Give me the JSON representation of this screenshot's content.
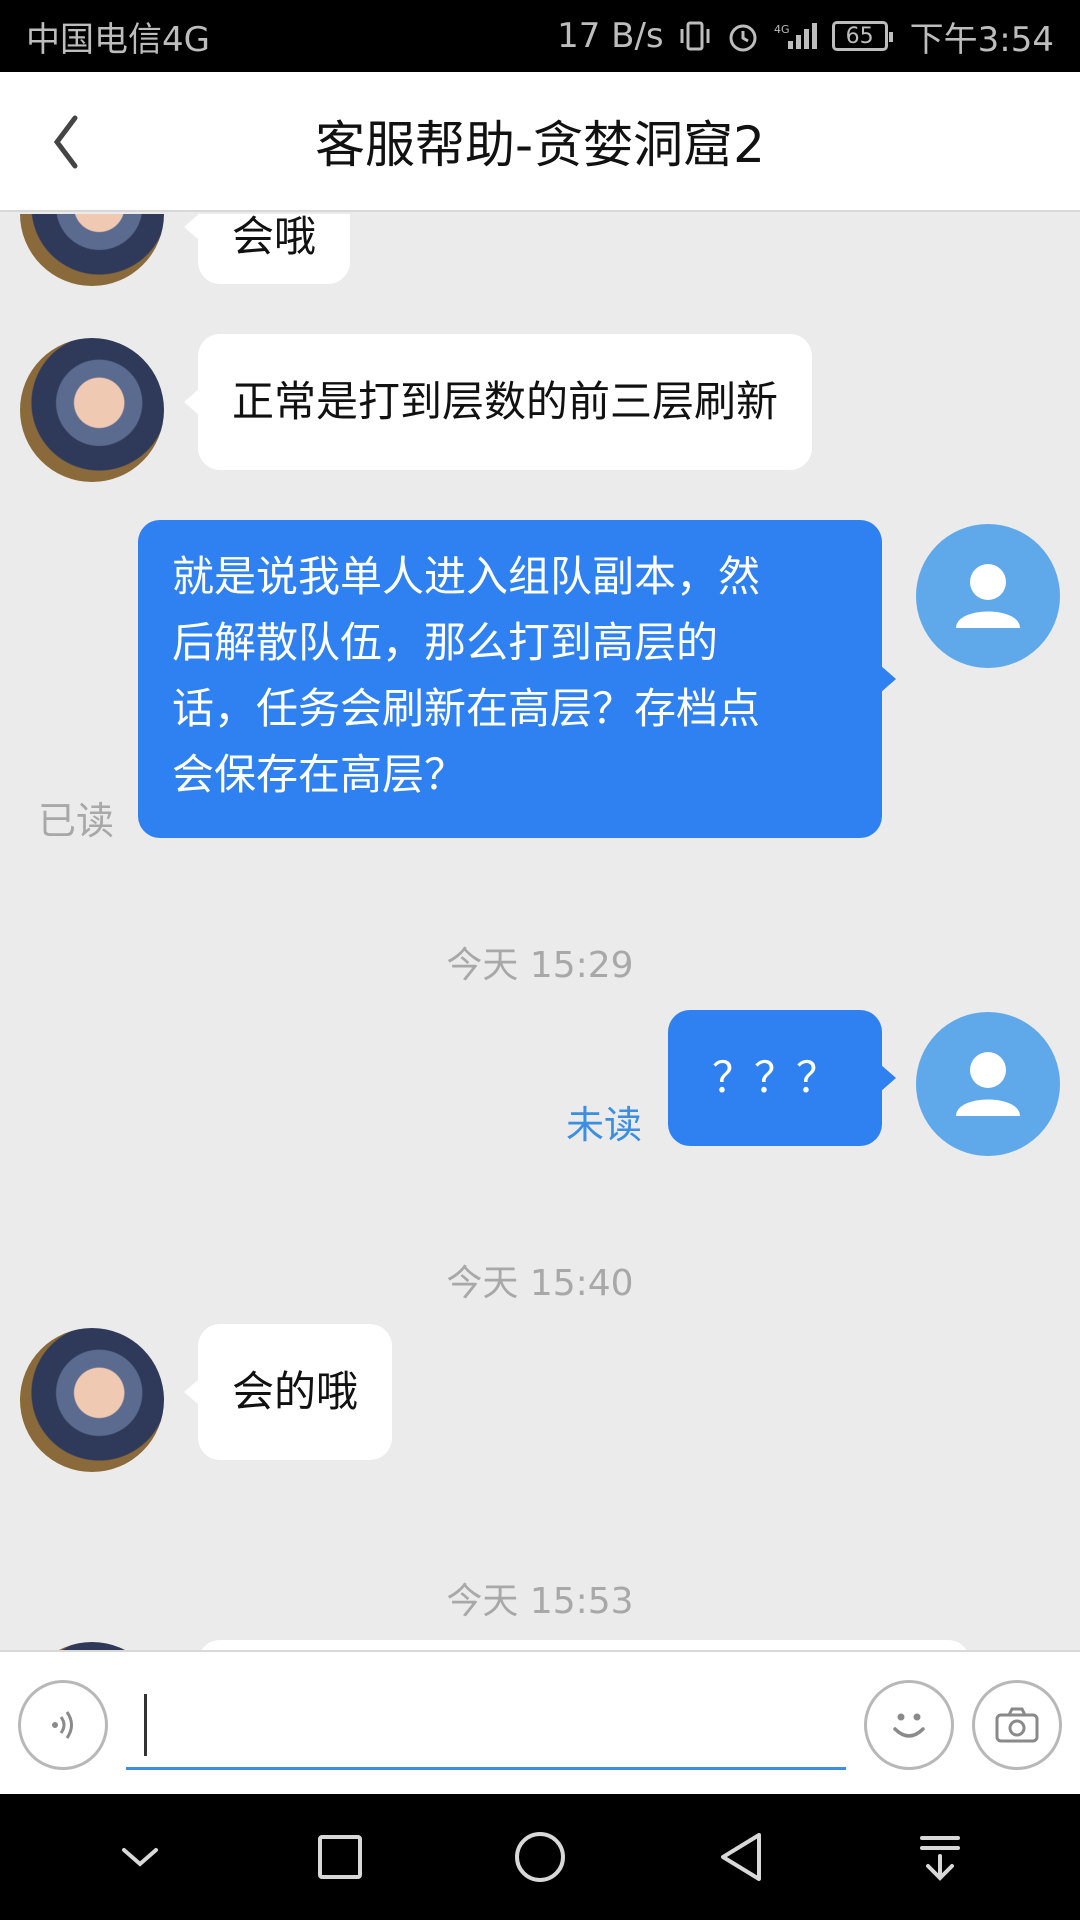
{
  "status_bar": {
    "carrier": "中国电信4G",
    "net_speed": "17 B/s",
    "battery": "65",
    "time": "下午3:54"
  },
  "header": {
    "title": "客服帮助-贪婪洞窟2"
  },
  "messages": [
    {
      "side": "in",
      "text": "会哦"
    },
    {
      "side": "in",
      "text": "正常是打到层数的前三层刷新"
    },
    {
      "side": "out",
      "lines": [
        "就是说我单人进入组队副本，然",
        "后解散队伍，那么打到高层的",
        "话，任务会刷新在高层？存档点",
        "会保存在高层？"
      ],
      "status": "已读"
    },
    {
      "type": "timestamp",
      "text": "今天 15:29"
    },
    {
      "side": "out",
      "text": "？？？",
      "status": "未读"
    },
    {
      "type": "timestamp",
      "text": "今天 15:40"
    },
    {
      "side": "in",
      "text": "会的哦"
    },
    {
      "type": "timestamp",
      "text": "今天 15:53"
    }
  ],
  "colors": {
    "outgoing_bubble": "#2f80f0",
    "incoming_bubble": "#ffffff",
    "read_status": "#a8a8a8",
    "unread_status": "#3b8ee0",
    "user_avatar": "#5fa8ea"
  },
  "input": {
    "value": "",
    "voice_icon": "voice-icon",
    "emoji_icon": "smiley-icon",
    "camera_icon": "camera-icon"
  },
  "nav": [
    "chevron-down-icon",
    "square-icon",
    "circle-icon",
    "triangle-back-icon",
    "notification-pull-icon"
  ]
}
